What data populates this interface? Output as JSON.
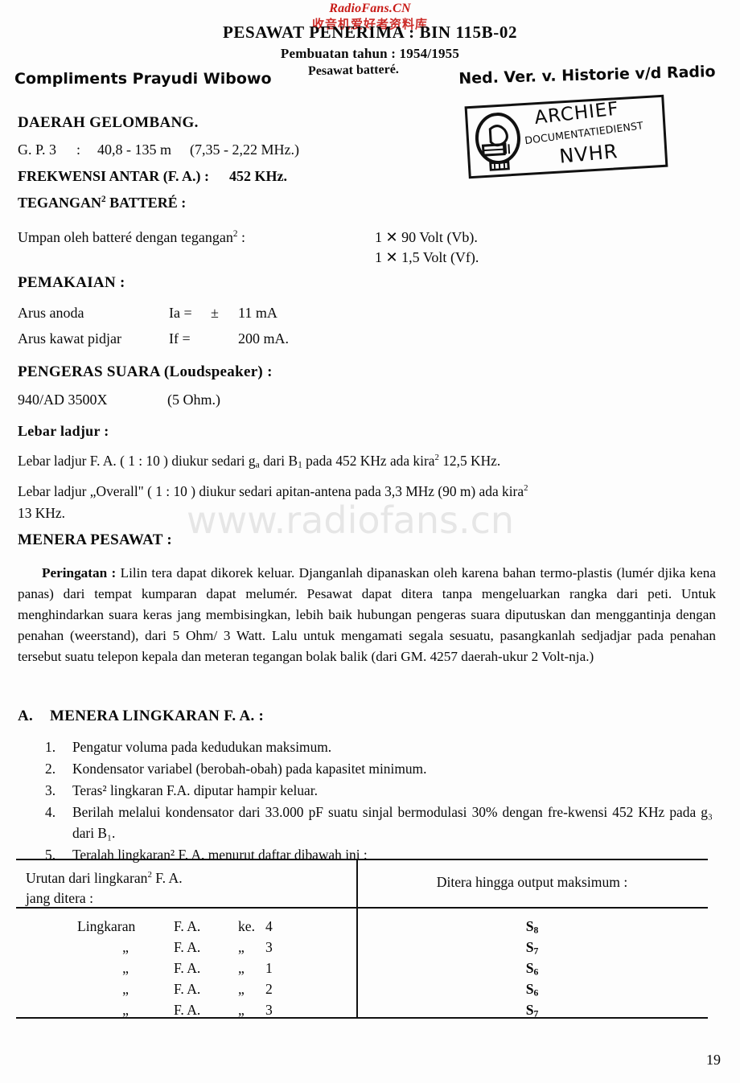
{
  "watermarks": {
    "red_main": "RadioFans.CN",
    "red_cn": "收音机爱好者资料库",
    "gray": "www.radiofans.cn"
  },
  "header": {
    "title": "PESAWAT  PENERIMA :  BIN  115B-02",
    "subtitle": "Pembuatan tahun : 1954/1955",
    "battery_note": "Pesawat batteré.",
    "compliments": "Compliments Prayudi Wibowo",
    "org_line": "Ned. Ver. v. Historie v/d Radio"
  },
  "stamp": {
    "line1": "ARCHIEF",
    "line2": "DOCUMENTATIEDIENST",
    "line3": "NVHR",
    "icon": "radio-tube-icon"
  },
  "sections": {
    "daerah_gelombang": {
      "heading": "DAERAH GELOMBANG.",
      "gp_label": "G. P. 3",
      "gp_sep": ":",
      "gp_range": "40,8 - 135 m",
      "gp_freq": "(7,35 - 2,22 MHz.)"
    },
    "frekwensi_antar": {
      "label": "FREKWENSI ANTAR (F. A.) :",
      "value": "452 KHz."
    },
    "tegangan": {
      "heading_pre": "TEGANGAN",
      "heading_sup": "2",
      "heading_post": " BATTERÉ :",
      "row_label_pre": "Umpan oleh batteré dengan tegangan",
      "row_label_sup": "2",
      "row_label_post": " :",
      "values": [
        "1  ✕  90  Volt   (Vb).",
        "1  ✕  1,5 Volt   (Vf)."
      ]
    },
    "pemakaian": {
      "heading": "PEMAKAIAN :",
      "rows": [
        {
          "label": "Arus anoda",
          "sym": "Ia =",
          "pm": "±",
          "value": "11 mA"
        },
        {
          "label": "Arus kawat pidjar",
          "sym": "If =",
          "pm": "",
          "value": "200 mA."
        }
      ]
    },
    "pengeras_suara": {
      "heading": "PENGERAS SUARA (Loudspeaker) :",
      "value": "940/AD 3500X",
      "impedance": "(5 Ohm.)"
    },
    "lebar_ladjur": {
      "heading": "Lebar ladjur :",
      "line1_a": "Lebar ladjur F. A. ( 1 : 10 ) diukur sedari g",
      "line1_sub": "a",
      "line1_b": " dari B",
      "line1_sub2": "1",
      "line1_c": " pada 452 KHz ada kira",
      "line1_sup": "2",
      "line1_d": " 12,5 KHz.",
      "line2_a": "Lebar ladjur „Overall\" ( 1 : 10 ) diukur sedari apitan-antena pada 3,3  MHz  (90 m)  ada  kira",
      "line2_sup": "2",
      "line2_b": "13 KHz."
    },
    "menera_pesawat": {
      "heading": "MENERA PESAWAT :",
      "warning_label": "Peringatan :",
      "warning_text": "Lilin tera dapat dikorek keluar. Djanganlah dipanaskan oleh karena bahan termo-plastis (lumér djika kena panas) dari tempat kumparan dapat melumér. Pesawat dapat ditera tanpa mengeluarkan rangka dari peti. Untuk menghindarkan suara keras jang membisingkan, lebih baik hubungan pengeras suara diputuskan dan menggantinja dengan penahan (weerstand), dari 5 Ohm/ 3 Watt. Lalu untuk mengamati segala sesuatu, pasangkanlah sedjadjar pada penahan tersebut suatu telepon kepala dan meteran tegangan bolak balik (dari GM. 4257 daerah-ukur 2 Volt-nja.)"
    },
    "menera_lingkaran": {
      "letter": "A.",
      "heading": "MENERA LINGKARAN F. A. :",
      "items": [
        {
          "num": "1.",
          "text": "Pengatur voluma pada kedudukan maksimum."
        },
        {
          "num": "2.",
          "text": "Kondensator variabel (berobah-obah) pada kapasitet minimum."
        },
        {
          "num": "3.",
          "text": "Teras² lingkaran F.A. diputar hampir keluar."
        },
        {
          "num": "4.",
          "text": "Berilah melalui kondensator dari 33.000  pF suatu sinjal bermodulasi 30%  dengan fre-kwensi 452 KHz pada g₃ dari B₁."
        },
        {
          "num": "5.",
          "text": "Teralah lingkaran² F. A. menurut daftar dibawah ini :"
        }
      ]
    }
  },
  "table": {
    "header_left_line1_a": "Urutan dari lingkaran",
    "header_left_line1_sup": "2",
    "header_left_line1_b": " F. A.",
    "header_left_line2": "jang ditera :",
    "header_right": "Ditera hingga output maksimum :",
    "rows": [
      {
        "label": "Lingkaran",
        "fa": "F. A.",
        "ke": "ke.",
        "no": "4",
        "s_base": "S",
        "s_sub": "8"
      },
      {
        "label": "„",
        "fa": "F. A.",
        "ke": "„",
        "no": "3",
        "s_base": "S",
        "s_sub": "7"
      },
      {
        "label": "„",
        "fa": "F. A.",
        "ke": "„",
        "no": "1",
        "s_base": "S",
        "s_sub": "6"
      },
      {
        "label": "„",
        "fa": "F. A.",
        "ke": "„",
        "no": "2",
        "s_base": "S",
        "s_sub": "6"
      },
      {
        "label": "„",
        "fa": "F. A.",
        "ke": "„",
        "no": "3",
        "s_base": "S",
        "s_sub": "7"
      }
    ]
  },
  "footer": {
    "page_number": "19"
  }
}
